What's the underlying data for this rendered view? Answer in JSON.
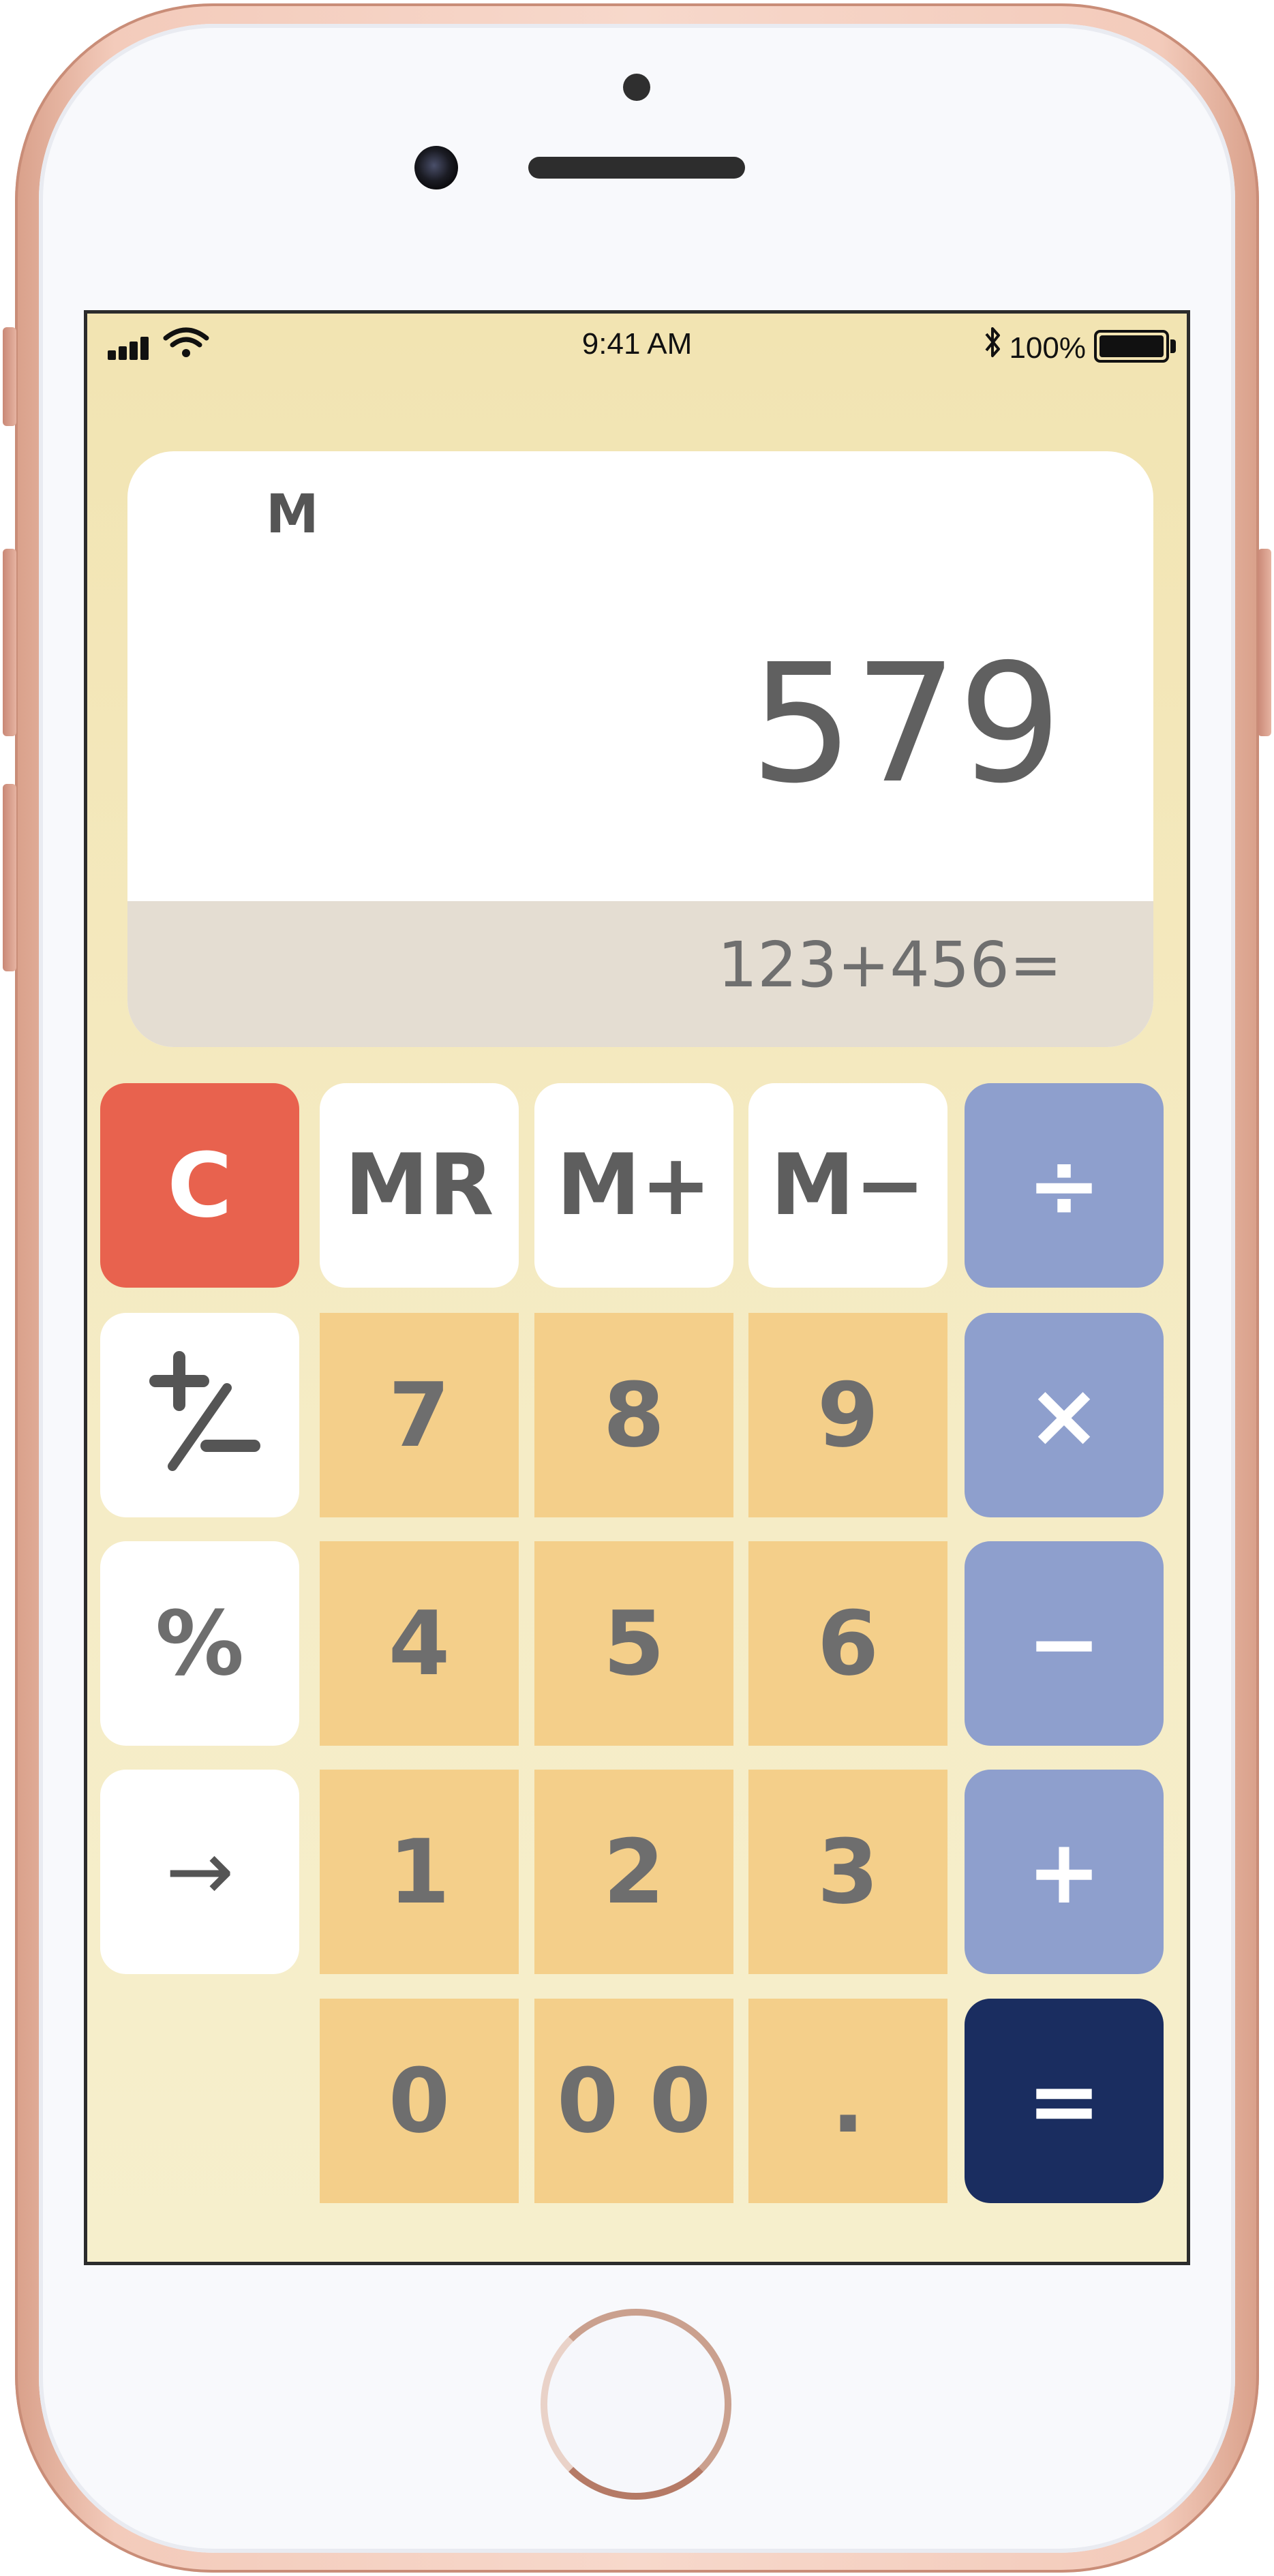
{
  "status_bar": {
    "time": "9:41 AM",
    "battery": "100%"
  },
  "display": {
    "memory_indicator": "M",
    "result": "579",
    "expression": "123+456="
  },
  "keys": {
    "clear": "C",
    "memory_recall": "MR",
    "memory_add": "M+",
    "memory_subtract": "M−",
    "divide": "÷",
    "plus_minus": "+/−",
    "seven": "7",
    "eight": "8",
    "nine": "9",
    "multiply": "×",
    "percent": "%",
    "four": "4",
    "five": "5",
    "six": "6",
    "minus": "−",
    "backspace": "→",
    "one": "1",
    "two": "2",
    "three": "3",
    "plus": "+",
    "zero": "0",
    "double_zero": "0 0",
    "decimal": ".",
    "equals": "="
  },
  "colors": {
    "background": "#f2e4b2",
    "number_key": "#f4cf8a",
    "operator_key": "#8e9fcd",
    "clear_key": "#e8624e",
    "equals_key": "#1a2d60"
  }
}
